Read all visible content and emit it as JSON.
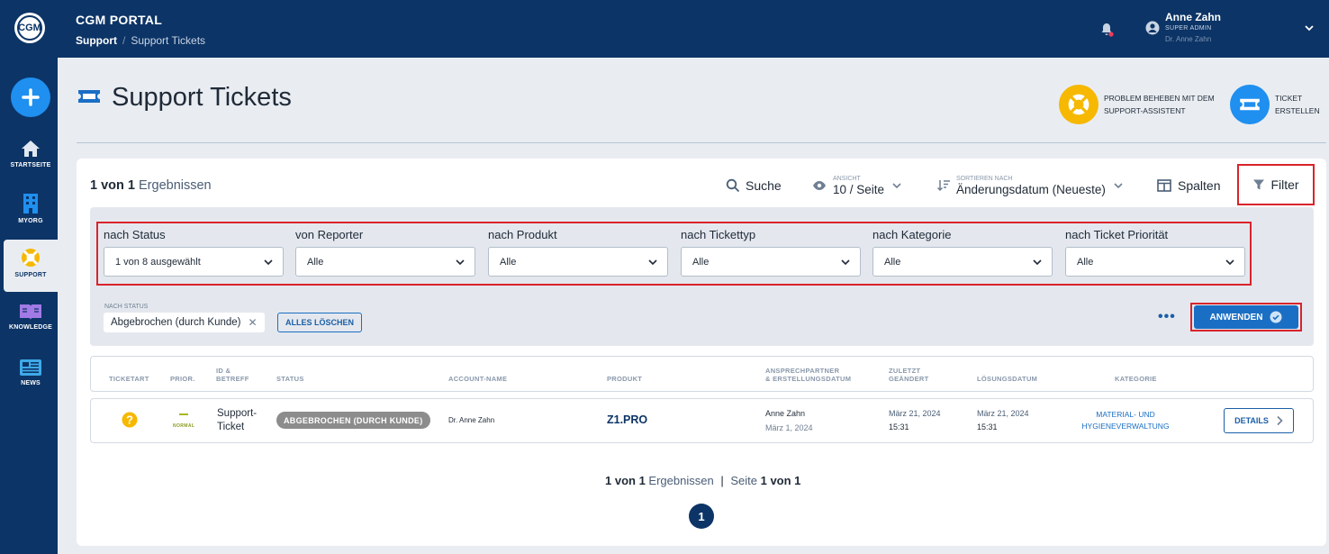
{
  "app": {
    "logo_text": "CGM",
    "title": "CGM PORTAL"
  },
  "breadcrumb": {
    "items": [
      "Support",
      "Support Tickets"
    ],
    "separator": "/"
  },
  "user": {
    "name": "Anne Zahn",
    "role": "SUPER ADMIN",
    "org": "Dr. Anne Zahn"
  },
  "sidebar": {
    "items": [
      {
        "label": "STARTSEITE",
        "icon": "home-icon"
      },
      {
        "label": "MYORG",
        "icon": "building-icon"
      },
      {
        "label": "SUPPORT",
        "icon": "lifebuoy-icon",
        "active": true
      },
      {
        "label": "KNOWLEDGE",
        "icon": "book-icon"
      },
      {
        "label": "NEWS",
        "icon": "newspaper-icon"
      }
    ]
  },
  "page": {
    "title": "Support Tickets",
    "actions": [
      {
        "label_line1": "PROBLEM BEHEBEN MIT DEM",
        "label_line2": "SUPPORT-ASSISTENT",
        "icon": "lifebuoy-icon",
        "color": "#f6b800"
      },
      {
        "label_line1": "TICKET",
        "label_line2": "ERSTELLEN",
        "icon": "ticket-icon",
        "color": "#1f8ff0"
      }
    ]
  },
  "toolbar": {
    "count": "1 von 1",
    "count_suffix": "Ergebnissen",
    "search": "Suche",
    "view_small": "ANSICHT",
    "view_value": "10 / Seite",
    "sort_small": "SORTIEREN NACH",
    "sort_value": "Änderungsdatum (Neueste)",
    "columns": "Spalten",
    "filter": "Filter"
  },
  "filters": [
    {
      "label": "nach Status",
      "value": "1 von 8 ausgewählt"
    },
    {
      "label": "von Reporter",
      "value": "Alle"
    },
    {
      "label": "nach Produkt",
      "value": "Alle"
    },
    {
      "label": "nach Tickettyp",
      "value": "Alle"
    },
    {
      "label": "nach Kategorie",
      "value": "Alle"
    },
    {
      "label": "nach Ticket Priorität",
      "value": "Alle"
    }
  ],
  "active_filter": {
    "label": "NACH STATUS",
    "chip": "Abgebrochen (durch Kunde)",
    "clear": "ALLES LÖSCHEN",
    "apply": "ANWENDEN"
  },
  "table": {
    "headers": {
      "ticketart": "TICKETART",
      "prior": "PRIOR.",
      "id_line1": "ID &",
      "id_line2": "BETREFF",
      "status": "STATUS",
      "account": "ACCOUNT-NAME",
      "produkt": "PRODUKT",
      "contact_line1": "ANSPRECHPARTNER",
      "contact_line2": "& ERSTELLUNGSDATUM",
      "changed_line1": "ZULETZT",
      "changed_line2": "GEÄNDERT",
      "resolution": "LÖSUNGSDATUM",
      "kategorie": "KATEGORIE"
    },
    "rows": [
      {
        "priority": "NORMAL",
        "subject_line1": "Support-",
        "subject_line2": "Ticket",
        "status": "ABGEBROCHEN (DURCH KUNDE)",
        "account": "Dr. Anne Zahn",
        "product": "Z1.PRO",
        "contact": "Anne Zahn",
        "created": "März 1, 2024",
        "changed_date": "März 21, 2024",
        "changed_time": "15:31",
        "resolved_date": "März 21, 2024",
        "resolved_time": "15:31",
        "category_line1": "MATERIAL- UND",
        "category_line2": "HYGIENEVERWALTUNG",
        "action": "DETAILS"
      }
    ]
  },
  "pager": {
    "count": "1 von 1",
    "count_suffix": "Ergebnissen",
    "page_prefix": "Seite",
    "page_value": "1 von 1",
    "current": "1"
  }
}
